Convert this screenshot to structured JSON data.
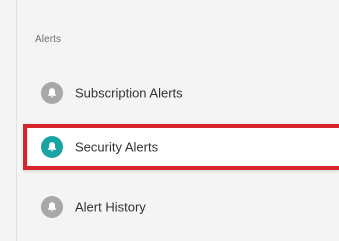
{
  "alerts_section": {
    "heading": "Alerts",
    "items": [
      {
        "label": "Subscription Alerts",
        "icon": "bell-icon",
        "icon_color": "#a8a8a8",
        "selected": false
      },
      {
        "label": "Security Alerts",
        "icon": "bell-icon",
        "icon_color": "#1aa3a3",
        "selected": true
      },
      {
        "label": "Alert History",
        "icon": "bell-icon",
        "icon_color": "#a8a8a8",
        "selected": false
      }
    ]
  },
  "colors": {
    "highlight_border": "#d9242a",
    "selected_background": "#ffffff",
    "panel_background": "#f4f4f4"
  }
}
